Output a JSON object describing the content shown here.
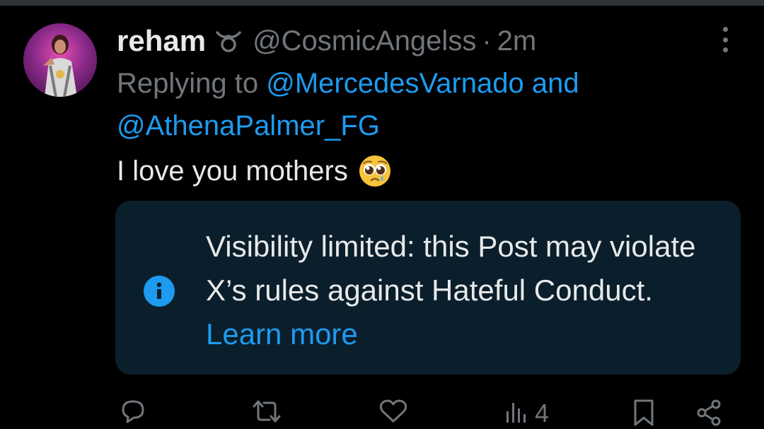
{
  "tweet": {
    "author": {
      "display_name": "reham",
      "handle": "@CosmicAngelss",
      "badge_icon": "taurus-icon"
    },
    "separator": "·",
    "timestamp": "2m",
    "replying_prefix": "Replying to",
    "replying_to": [
      "@MercedesVarnado",
      "@AthenaPalmer_FG"
    ],
    "replying_joiner": "and",
    "text": "I love you mothers",
    "emoji_icon": "pleading-face-icon",
    "notice": {
      "icon": "info-icon",
      "message": "Visibility limited: this Post may violate X’s rules against Hateful Conduct.",
      "link_label": "Learn more"
    },
    "actions": {
      "reply_icon": "reply-icon",
      "repost_icon": "repost-icon",
      "like_icon": "like-icon",
      "views_icon": "views-icon",
      "views_count": "4",
      "bookmark_icon": "bookmark-icon",
      "share_icon": "share-icon"
    }
  },
  "colors": {
    "background": "#000000",
    "primary_text": "#e7e9ea",
    "secondary_text": "#71767b",
    "accent": "#1d9bf0",
    "notice_background": "#0b1e2b"
  }
}
